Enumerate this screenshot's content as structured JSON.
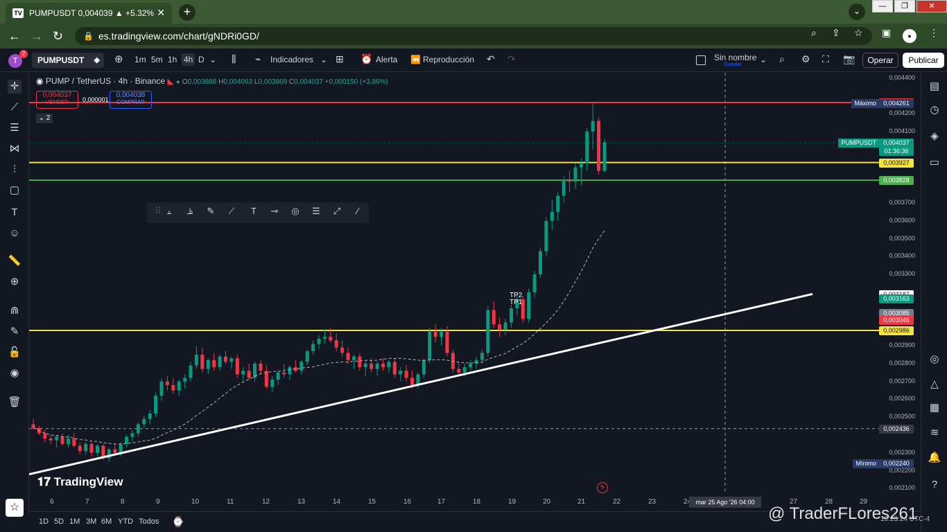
{
  "browser": {
    "tab_title": "PUMPUSDT 0,004039 ▲ +5.32% ",
    "url": "es.tradingview.com/chart/gNDRi0GD/",
    "tab_icon": "tradingview-logo-icon"
  },
  "toolbar": {
    "avatar_letter": "T",
    "avatar_badge": "2",
    "symbol": "PUMPUSDT",
    "timeframes": [
      "1m",
      "5m",
      "1h",
      "4h",
      "D"
    ],
    "active_timeframe": "4h",
    "indicators_label": "Indicadores",
    "alert_label": "Alerta",
    "replay_label": "Reproducción",
    "layout_name": "Sin nombre",
    "layout_save": "Guardar",
    "trade_label": "Operar",
    "publish_label": "Publicar"
  },
  "legend": {
    "title": "PUMP / TetherUS · 4h · Binance",
    "o_label": "O",
    "o_value": "0,003888",
    "h_label": "H",
    "h_value": "0,004063",
    "l_label": "L",
    "l_value": "0,003869",
    "c_label": "C",
    "c_value": "0,004037",
    "change": "+0,000150 (+3,86%)",
    "sell_price": "0,004037",
    "sell_label": "VENDER",
    "spread": "0,000001",
    "buy_price": "0,004038",
    "buy_label": "COMPRAR",
    "collapse_count": "2"
  },
  "chart_data": {
    "type": "candlestick",
    "symbol": "PUMPUSDT",
    "x_ticks": [
      "6",
      "7",
      "8",
      "9",
      "10",
      "11",
      "12",
      "13",
      "14",
      "15",
      "16",
      "17",
      "18",
      "19",
      "20",
      "21",
      "22",
      "23",
      "24",
      "27",
      "28",
      "29"
    ],
    "crosshair_time": "mar 25 Ago '26  04:00",
    "y_ticks": [
      "0,004400",
      "0,004200",
      "0,004100",
      "0,003700",
      "0,003600",
      "0,003500",
      "0,003400",
      "0,003300",
      "0,002900",
      "0,002800",
      "0,002700",
      "0,002600",
      "0,002500",
      "0,002300",
      "0,002200",
      "0,002100"
    ],
    "ylim": [
      0.00207,
      0.00443
    ],
    "horizontal_lines": [
      {
        "price": 0.004263,
        "label": "0,004263",
        "color": "#f23645"
      },
      {
        "price": 0.003927,
        "label": "0,003927",
        "color": "#f5e342"
      },
      {
        "price": 0.003828,
        "label": "0,003828",
        "color": "#4caf50"
      },
      {
        "price": 0.002986,
        "label": "0,002986",
        "color": "#f5e342"
      }
    ],
    "price_tags": [
      {
        "price": 0.004261,
        "label": "0,004261",
        "side_label": "Máximo",
        "bg": "#2a3a66"
      },
      {
        "price": 0.004037,
        "label": "0,004037",
        "side_label": "PUMPUSDT",
        "sub": "01:36:36",
        "bg": "#089981"
      },
      {
        "price": 0.003187,
        "label": "0,003187",
        "bg": "#ffffff",
        "fg": "#131722"
      },
      {
        "price": 0.003163,
        "label": "0,003163",
        "bg": "#089981"
      },
      {
        "price": 0.003085,
        "label": "0,003085",
        "bg": "#787b86"
      },
      {
        "price": 0.003046,
        "label": "0,003046",
        "bg": "#f23645"
      },
      {
        "price": 0.002436,
        "label": "0,002436",
        "bg": "#363a45"
      },
      {
        "price": 0.00224,
        "label": "0,002240",
        "side_label": "Mínimo",
        "bg": "#2a3a66"
      }
    ],
    "annotations": [
      "TP2",
      "TP1"
    ],
    "candles": [
      [
        0.00246,
        0.00249,
        0.00243,
        0.00244
      ],
      [
        0.00244,
        0.00245,
        0.0024,
        0.00241
      ],
      [
        0.00241,
        0.00243,
        0.00236,
        0.00238
      ],
      [
        0.00238,
        0.0024,
        0.00235,
        0.00237
      ],
      [
        0.00237,
        0.0024,
        0.00233,
        0.00239
      ],
      [
        0.00239,
        0.00241,
        0.00234,
        0.00235
      ],
      [
        0.00235,
        0.0024,
        0.00233,
        0.00238
      ],
      [
        0.00238,
        0.00241,
        0.00233,
        0.00234
      ],
      [
        0.00234,
        0.00236,
        0.00229,
        0.00231
      ],
      [
        0.00231,
        0.00236,
        0.00229,
        0.00235
      ],
      [
        0.00235,
        0.00236,
        0.00228,
        0.0023
      ],
      [
        0.0023,
        0.00235,
        0.00228,
        0.00234
      ],
      [
        0.00234,
        0.00235,
        0.00226,
        0.00227
      ],
      [
        0.00227,
        0.00233,
        0.00225,
        0.00232
      ],
      [
        0.00232,
        0.00235,
        0.00229,
        0.0023
      ],
      [
        0.0023,
        0.00236,
        0.00228,
        0.00235
      ],
      [
        0.00235,
        0.0024,
        0.00233,
        0.00239
      ],
      [
        0.00239,
        0.00243,
        0.00236,
        0.00241
      ],
      [
        0.00241,
        0.00247,
        0.00239,
        0.00246
      ],
      [
        0.00246,
        0.00251,
        0.00244,
        0.00249
      ],
      [
        0.00249,
        0.00254,
        0.00246,
        0.00252
      ],
      [
        0.00252,
        0.00264,
        0.0025,
        0.00262
      ],
      [
        0.00262,
        0.00272,
        0.00259,
        0.0027
      ],
      [
        0.0027,
        0.00273,
        0.00265,
        0.00268
      ],
      [
        0.00268,
        0.00272,
        0.00263,
        0.00265
      ],
      [
        0.00265,
        0.00271,
        0.00262,
        0.0027
      ],
      [
        0.0027,
        0.00274,
        0.00266,
        0.00272
      ],
      [
        0.00272,
        0.00281,
        0.0027,
        0.00279
      ],
      [
        0.00279,
        0.0029,
        0.00277,
        0.00285
      ],
      [
        0.00285,
        0.00289,
        0.00275,
        0.00277
      ],
      [
        0.00277,
        0.00283,
        0.00274,
        0.00282
      ],
      [
        0.00282,
        0.00286,
        0.00276,
        0.00278
      ],
      [
        0.00278,
        0.00285,
        0.00276,
        0.00284
      ],
      [
        0.00284,
        0.00287,
        0.0028,
        0.00281
      ],
      [
        0.00281,
        0.00284,
        0.00277,
        0.00283
      ],
      [
        0.00283,
        0.00285,
        0.00272,
        0.00274
      ],
      [
        0.00274,
        0.00278,
        0.0027,
        0.00276
      ],
      [
        0.00276,
        0.0028,
        0.00271,
        0.00272
      ],
      [
        0.00272,
        0.00281,
        0.0027,
        0.0028
      ],
      [
        0.0028,
        0.00282,
        0.00274,
        0.00276
      ],
      [
        0.00276,
        0.00279,
        0.00266,
        0.00267
      ],
      [
        0.00267,
        0.00273,
        0.00264,
        0.00271
      ],
      [
        0.00271,
        0.00276,
        0.00268,
        0.00275
      ],
      [
        0.00275,
        0.0028,
        0.00272,
        0.00274
      ],
      [
        0.00274,
        0.00279,
        0.00271,
        0.00278
      ],
      [
        0.00278,
        0.00282,
        0.00275,
        0.00276
      ],
      [
        0.00276,
        0.00282,
        0.00274,
        0.00281
      ],
      [
        0.00281,
        0.00288,
        0.00279,
        0.00287
      ],
      [
        0.00287,
        0.00293,
        0.00285,
        0.00291
      ],
      [
        0.00291,
        0.00296,
        0.00288,
        0.00294
      ],
      [
        0.00294,
        0.00299,
        0.00291,
        0.00295
      ],
      [
        0.00295,
        0.003,
        0.00292,
        0.00293
      ],
      [
        0.00293,
        0.00297,
        0.00287,
        0.00289
      ],
      [
        0.00289,
        0.00293,
        0.00284,
        0.00286
      ],
      [
        0.00286,
        0.00289,
        0.0028,
        0.00282
      ],
      [
        0.00282,
        0.00285,
        0.00277,
        0.00284
      ],
      [
        0.00284,
        0.00286,
        0.00276,
        0.00278
      ],
      [
        0.00278,
        0.00282,
        0.00273,
        0.0028
      ],
      [
        0.0028,
        0.00283,
        0.00275,
        0.00277
      ],
      [
        0.00277,
        0.00281,
        0.00273,
        0.0028
      ],
      [
        0.0028,
        0.00283,
        0.00276,
        0.00278
      ],
      [
        0.00278,
        0.00282,
        0.00275,
        0.00281
      ],
      [
        0.00281,
        0.00283,
        0.00272,
        0.00274
      ],
      [
        0.00274,
        0.00278,
        0.0027,
        0.00276
      ],
      [
        0.00276,
        0.00279,
        0.0027,
        0.00272
      ],
      [
        0.00272,
        0.00276,
        0.00266,
        0.00268
      ],
      [
        0.00268,
        0.00275,
        0.00266,
        0.00274
      ],
      [
        0.00274,
        0.00283,
        0.00272,
        0.00282
      ],
      [
        0.00282,
        0.003,
        0.0028,
        0.00298
      ],
      [
        0.00298,
        0.00302,
        0.00292,
        0.00295
      ],
      [
        0.00295,
        0.003,
        0.0029,
        0.00298
      ],
      [
        0.00298,
        0.00301,
        0.00284,
        0.00286
      ],
      [
        0.00286,
        0.00288,
        0.00275,
        0.00277
      ],
      [
        0.00277,
        0.00281,
        0.00273,
        0.00275
      ],
      [
        0.00275,
        0.0028,
        0.00273,
        0.00278
      ],
      [
        0.00278,
        0.00282,
        0.00276,
        0.0028
      ],
      [
        0.0028,
        0.00284,
        0.00277,
        0.00282
      ],
      [
        0.00282,
        0.00288,
        0.0028,
        0.00286
      ],
      [
        0.00286,
        0.00312,
        0.00284,
        0.0031
      ],
      [
        0.0031,
        0.00315,
        0.003,
        0.00302
      ],
      [
        0.00302,
        0.00306,
        0.00295,
        0.00299
      ],
      [
        0.00299,
        0.00305,
        0.00296,
        0.00303
      ],
      [
        0.00303,
        0.00313,
        0.003,
        0.00311
      ],
      [
        0.00311,
        0.00319,
        0.00307,
        0.00316
      ],
      [
        0.00316,
        0.00318,
        0.00303,
        0.00305
      ],
      [
        0.00305,
        0.00322,
        0.00303,
        0.0032
      ],
      [
        0.0032,
        0.00332,
        0.00317,
        0.0033
      ],
      [
        0.0033,
        0.00345,
        0.00328,
        0.00343
      ],
      [
        0.00343,
        0.00362,
        0.0034,
        0.0036
      ],
      [
        0.0036,
        0.00372,
        0.00355,
        0.00365
      ],
      [
        0.00365,
        0.00376,
        0.0036,
        0.00374
      ],
      [
        0.00374,
        0.00385,
        0.0037,
        0.00383
      ],
      [
        0.00383,
        0.00388,
        0.00376,
        0.00382
      ],
      [
        0.00382,
        0.00392,
        0.00378,
        0.0039
      ],
      [
        0.0039,
        0.00395,
        0.0038,
        0.00392
      ],
      [
        0.00392,
        0.00412,
        0.00388,
        0.0041
      ],
      [
        0.0041,
        0.00426,
        0.004,
        0.00416
      ],
      [
        0.00416,
        0.00418,
        0.00386,
        0.00388
      ],
      [
        0.00388,
        0.00406,
        0.00387,
        0.00404
      ]
    ],
    "trendline": {
      "from": [
        0.00218,
        0
      ],
      "to": [
        0.00319,
        1
      ]
    },
    "moving_average": "dashed"
  },
  "time_axis": [
    "6",
    "7",
    "8",
    "9",
    "10",
    "11",
    "12",
    "13",
    "14",
    "15",
    "16",
    "17",
    "18",
    "19",
    "20",
    "21",
    "22",
    "23",
    "24",
    "27",
    "28",
    "29"
  ],
  "bottom": {
    "ranges": [
      "1D",
      "5D",
      "1M",
      "3M",
      "6M",
      "YTD",
      "Todos"
    ],
    "clock": "18:23:24 UTC-4",
    "watermark": "TradingView",
    "credit": "@ TraderFLores261"
  },
  "colors": {
    "up": "#089981",
    "down": "#f23645",
    "bg": "#131722",
    "trend": "#ffffff",
    "ma": "#b2b5be"
  }
}
